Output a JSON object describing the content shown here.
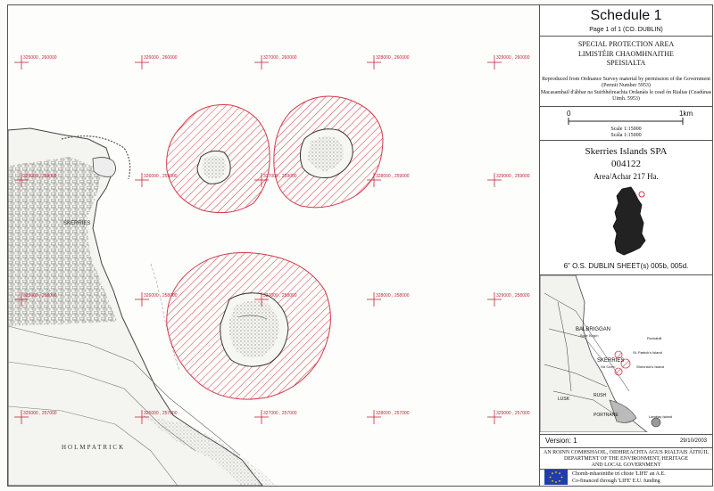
{
  "schedule": {
    "title": "Schedule 1",
    "page": "Page 1 of 1 (CO. DUBLIN)"
  },
  "designation": {
    "line1": "SPECIAL PROTECTION AREA",
    "line2": "LIMISTÉIR CHAOMHNAITHE",
    "line3": "SPEISIALTA"
  },
  "notes": {
    "line1": "Reproduced from Ordnance Survey material by permission of the Government (Permit Number 5953)",
    "line2": "Macasamhail d'ábhar na Suirbhéireachta Ordanáis le cead ón Rialtas (Ceadúnas Uimh. 5953)"
  },
  "scale": {
    "start": "0",
    "end": "1km",
    "label_en": "Scale 1:15000",
    "label_ga": "Scála 1:15000"
  },
  "site": {
    "name": "Skerries Islands SPA",
    "code": "004122",
    "area": "Area/Achar 217 Ha."
  },
  "sheets": "6\" O.S.  DUBLIN   SHEET(s) 005b, 005d.",
  "locality_map": {
    "labels": {
      "balbriggan": "BALBRIGGAN",
      "balbriggan_ga": "Baile Brigín",
      "skerries": "SKERRIES",
      "skerries_ga": "Na Sceirí",
      "rush": "RUSH",
      "lusk": "LUSK",
      "rockabill": "Rockabill",
      "st_patricks": "St. Patrick's Island",
      "shennicks": "Shennick's Island",
      "portrane": "PORTRANE",
      "lambay": "Lambay Island"
    }
  },
  "version": {
    "label": "Version: 1",
    "date": "29/10/2003"
  },
  "department": {
    "line1": "AN ROINN COMHSHAOIL, OIDHREACHTA AGUS RIALTAIS ÁITIÚIL",
    "line2": "DEPARTMENT OF THE ENVIRONMENT, HERITAGE",
    "line3": "AND LOCAL GOVERNMENT"
  },
  "funding": {
    "line1": "Chomh-mhaoinithe trí chiste 'LIFE' an A.E.",
    "line2": "Co-financed through 'LIFE' E.U. funding"
  },
  "grid_labels": {
    "top": [
      "325000 , 260000",
      "326000 , 260000",
      "327000 , 260000",
      "328000 , 260000",
      "329000 , 260000"
    ],
    "mid": [
      "325000 , 259000",
      "326000 , 259000",
      "327000 , 259000",
      "328000 , 259000",
      "329000 , 259000"
    ],
    "low": [
      "325000 , 258000",
      "326000 , 258000",
      "327000 , 258000",
      "328000 , 258000",
      "329000 , 258000"
    ],
    "bottom": [
      "325000 , 257000",
      "326000 , 257000",
      "327000 , 257000",
      "328000 , 257000",
      "329000 , 257000"
    ]
  },
  "map_labels": {
    "town": "SKERRIES",
    "townland": "HOLMPATRICK"
  },
  "colors": {
    "hatch": "#d4394b",
    "grid": "#c0283c",
    "eu_blue": "#1f3fa8"
  }
}
